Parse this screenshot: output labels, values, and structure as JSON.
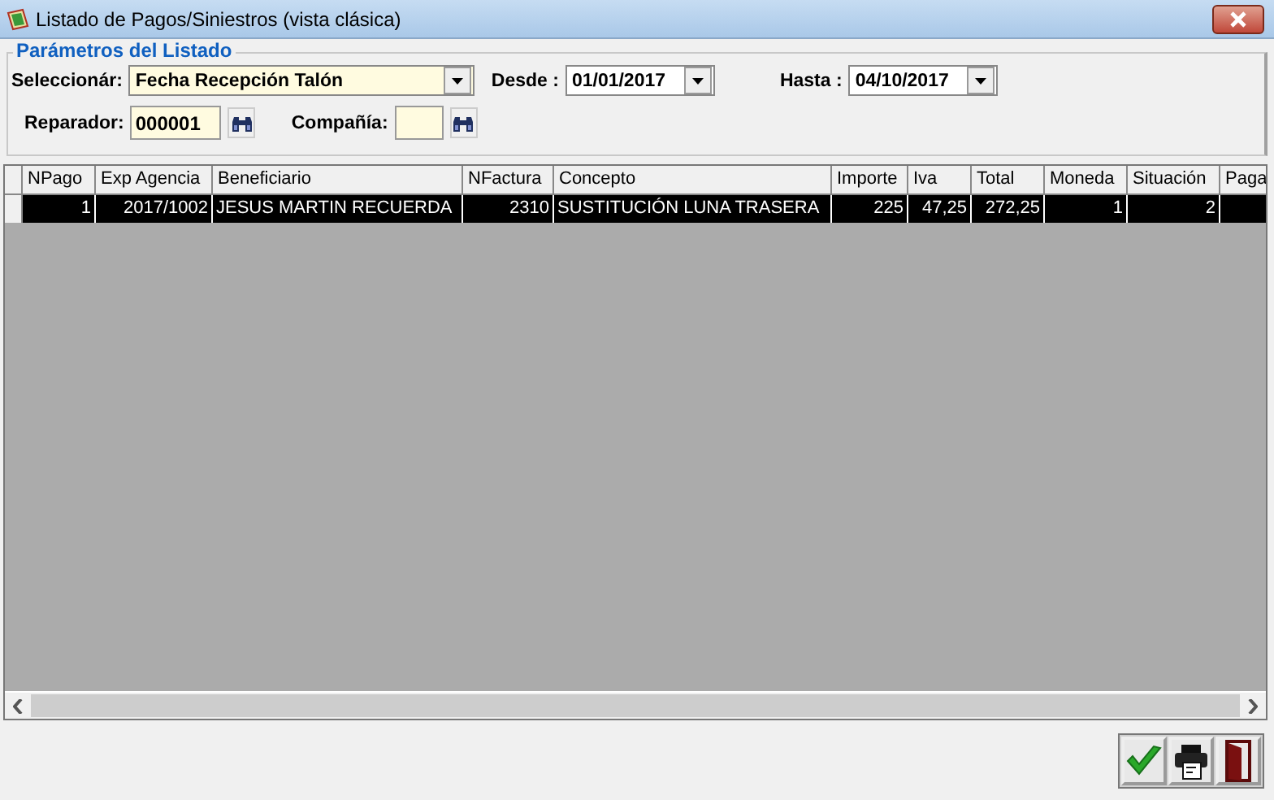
{
  "window": {
    "title": "Listado de Pagos/Siniestros (vista clásica)"
  },
  "parameters": {
    "legend": "Parámetros del Listado",
    "select_label": "Seleccionár:",
    "select_value": "Fecha Recepción Talón",
    "from_label": "Desde :",
    "from_value": "01/01/2017",
    "to_label": "Hasta :",
    "to_value": "04/10/2017",
    "repairer_label": "Reparador:",
    "repairer_value": "000001",
    "company_label": "Compañía:"
  },
  "table": {
    "columns": [
      "NPago",
      "Exp Agencia",
      "Beneficiario",
      "NFactura",
      "Concepto",
      "Importe",
      "Iva",
      "Total",
      "Moneda",
      "Situación",
      "Paga"
    ],
    "rows": [
      {
        "selected": true,
        "cells": [
          "1",
          "2017/1002",
          "JESUS MARTIN RECUERDA",
          "2310",
          "SUSTITUCIÓN LUNA TRASERA",
          "225",
          "47,25",
          "272,25",
          "1",
          "2"
        ]
      }
    ]
  }
}
